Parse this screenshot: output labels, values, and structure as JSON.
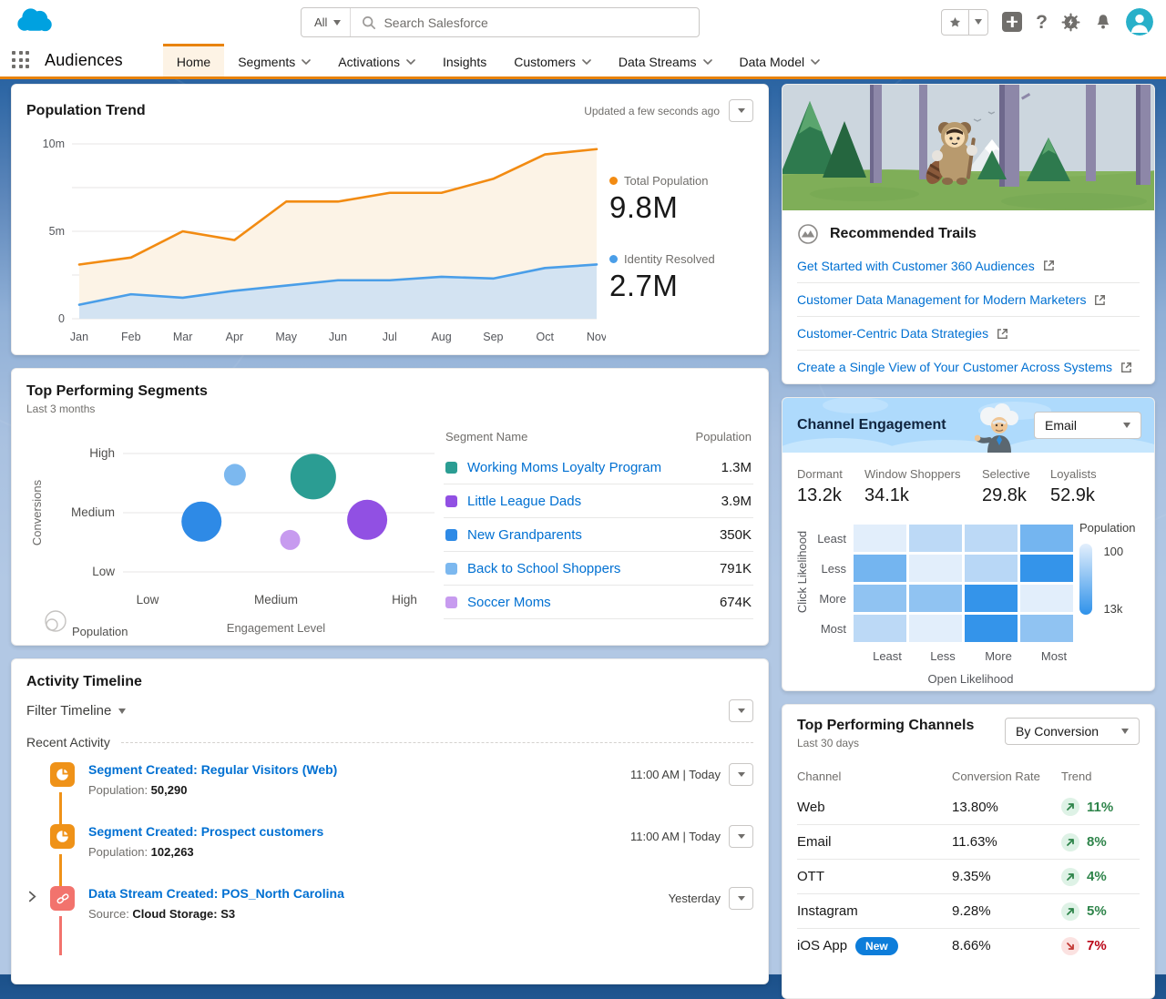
{
  "colors": {
    "accent": "#e8830c",
    "link": "#0070d2",
    "green": "#2e844a",
    "red": "#c23934",
    "badge_blue": "#0d7dda"
  },
  "header": {
    "app_name": "Audiences",
    "search": {
      "scope": "All",
      "placeholder": "Search Salesforce"
    },
    "tabs": [
      {
        "label": "Home",
        "active": true,
        "chevron": false
      },
      {
        "label": "Segments",
        "active": false,
        "chevron": true
      },
      {
        "label": "Activations",
        "active": false,
        "chevron": true
      },
      {
        "label": "Insights",
        "active": false,
        "chevron": false
      },
      {
        "label": "Customers",
        "active": false,
        "chevron": true
      },
      {
        "label": "Data Streams",
        "active": false,
        "chevron": true
      },
      {
        "label": "Data Model",
        "active": false,
        "chevron": true
      }
    ]
  },
  "population_trend": {
    "title": "Population Trend",
    "updated": "Updated a few seconds ago",
    "kpis": [
      {
        "label": "Total Population",
        "value": "9.8M",
        "color": "#f28b12"
      },
      {
        "label": "Identity Resolved",
        "value": "2.7M",
        "color": "#4a9ee8"
      }
    ],
    "chart_data": {
      "type": "area",
      "x": [
        "Jan",
        "Feb",
        "Mar",
        "Apr",
        "May",
        "Jun",
        "Jul",
        "Aug",
        "Sep",
        "Oct",
        "Nov"
      ],
      "series": [
        {
          "name": "Total Population",
          "color": "#f28b12",
          "fill": "#fcf3e6",
          "values": [
            3.1,
            3.5,
            5.0,
            4.5,
            6.7,
            6.7,
            7.2,
            7.2,
            8.0,
            9.4,
            9.7
          ]
        },
        {
          "name": "Identity Resolved",
          "color": "#4a9ee8",
          "fill": "#d3e3f2",
          "values": [
            0.8,
            1.4,
            1.2,
            1.6,
            1.9,
            2.2,
            2.2,
            2.4,
            2.3,
            2.9,
            3.1
          ]
        }
      ],
      "unit": "millions",
      "ylim": [
        0,
        10
      ],
      "gridlines": [
        0,
        2.5,
        5,
        7.5,
        10
      ],
      "yticks": [
        {
          "v": 10,
          "label": "10m"
        },
        {
          "v": 5,
          "label": "5m"
        },
        {
          "v": 0,
          "label": "0"
        }
      ],
      "legend_position": "right"
    }
  },
  "top_segments": {
    "title": "Top Performing Segments",
    "subtitle": "Last 3 months",
    "chart_data": {
      "type": "scatter",
      "xlabel": "Engagement Level",
      "ylabel": "Conversions",
      "x_ticks": [
        "Low",
        "Medium",
        "High"
      ],
      "y_ticks_top_to_bottom": [
        "High",
        "Medium",
        "Low"
      ],
      "size_legend_label": "Population",
      "points": [
        {
          "name": "New Grandparents",
          "x": 1.42,
          "y": 1.85,
          "r": 22,
          "color": "#2e8ae6"
        },
        {
          "name": "Back to School Shoppers",
          "x": 1.68,
          "y": 2.64,
          "r": 12,
          "color": "#7cb8ef"
        },
        {
          "name": "Working Moms Loyalty Program",
          "x": 2.29,
          "y": 2.61,
          "r": 25,
          "color": "#2b9d93"
        },
        {
          "name": "Soccer Moms",
          "x": 2.11,
          "y": 1.54,
          "r": 11,
          "color": "#c79bef"
        },
        {
          "name": "Little League Dads",
          "x": 2.71,
          "y": 1.88,
          "r": 22,
          "color": "#9150e3"
        }
      ]
    },
    "table": {
      "headers": [
        "Segment Name",
        "Population"
      ],
      "rows": [
        {
          "name": "Working Moms Loyalty Program",
          "population": "1.3M",
          "color": "#2b9d93"
        },
        {
          "name": "Little League Dads",
          "population": "3.9M",
          "color": "#9150e3"
        },
        {
          "name": "New Grandparents",
          "population": "350K",
          "color": "#2e8ae6"
        },
        {
          "name": "Back to School Shoppers",
          "population": "791K",
          "color": "#7cb8ef"
        },
        {
          "name": "Soccer Moms",
          "population": "674K",
          "color": "#c79bef"
        }
      ]
    }
  },
  "activity_timeline": {
    "title": "Activity Timeline",
    "filter_label": "Filter Timeline",
    "section_label": "Recent Activity",
    "items": [
      {
        "type": "segment",
        "icon_color": "#ef9218",
        "title": "Segment Created: Regular Visitors (Web)",
        "meta_label": "Population:",
        "meta_value": "50,290",
        "timestamp": "11:00 AM | Today",
        "expandable": false
      },
      {
        "type": "segment",
        "icon_color": "#ef9218",
        "title": "Segment Created: Prospect customers",
        "meta_label": "Population:",
        "meta_value": "102,263",
        "timestamp": "11:00 AM | Today",
        "expandable": false
      },
      {
        "type": "datastream",
        "icon_color": "#f2736d",
        "title": "Data Stream Created: POS_North Carolina",
        "meta_label": "Source:",
        "meta_value": "Cloud Storage: S3",
        "timestamp": "Yesterday",
        "expandable": true
      }
    ]
  },
  "trails": {
    "title": "Recommended Trails",
    "links": [
      "Get Started with Customer 360 Audiences",
      "Customer Data Management for Modern Marketers",
      "Customer-Centric Data Strategies",
      "Create a Single View of Your Customer Across Systems"
    ]
  },
  "channel_engagement": {
    "title": "Channel Engagement",
    "selected_channel": "Email",
    "stats": [
      {
        "label": "Dormant",
        "value": "13.2k"
      },
      {
        "label": "Window Shoppers",
        "value": "34.1k"
      },
      {
        "label": "Selective",
        "value": "29.8k"
      },
      {
        "label": "Loyalists",
        "value": "52.9k"
      }
    ],
    "chart_data": {
      "type": "heatmap",
      "rows": [
        "Least",
        "Less",
        "More",
        "Most"
      ],
      "cols": [
        "Least",
        "Less",
        "More",
        "Most"
      ],
      "xlabel": "Open Likelihood",
      "ylabel": "Click Likelihood",
      "legend": {
        "title": "Population",
        "top_label": "100",
        "bottom_label": "13k"
      },
      "cell_colors": [
        [
          "#e2eefb",
          "#bcd9f6",
          "#bcd9f6",
          "#74b5f0"
        ],
        [
          "#74b5f0",
          "#e2eefb",
          "#b8d7f6",
          "#3494ea"
        ],
        [
          "#90c3f2",
          "#90c3f2",
          "#3494ea",
          "#e2eefb"
        ],
        [
          "#bcd9f6",
          "#e2eefb",
          "#3494ea",
          "#90c3f2"
        ]
      ]
    }
  },
  "top_channels": {
    "title": "Top Performing Channels",
    "subtitle": "Last 30 days",
    "sort_label": "By Conversion",
    "headers": [
      "Channel",
      "Conversion Rate",
      "Trend"
    ],
    "rows": [
      {
        "channel": "Web",
        "rate": "13.80%",
        "trend": "11%",
        "direction": "up",
        "badge": null
      },
      {
        "channel": "Email",
        "rate": "11.63%",
        "trend": "8%",
        "direction": "up",
        "badge": null
      },
      {
        "channel": "OTT",
        "rate": "9.35%",
        "trend": "4%",
        "direction": "up",
        "badge": null
      },
      {
        "channel": "Instagram",
        "rate": "9.28%",
        "trend": "5%",
        "direction": "up",
        "badge": null
      },
      {
        "channel": "iOS App",
        "rate": "8.66%",
        "trend": "7%",
        "direction": "down",
        "badge": "New"
      }
    ]
  }
}
